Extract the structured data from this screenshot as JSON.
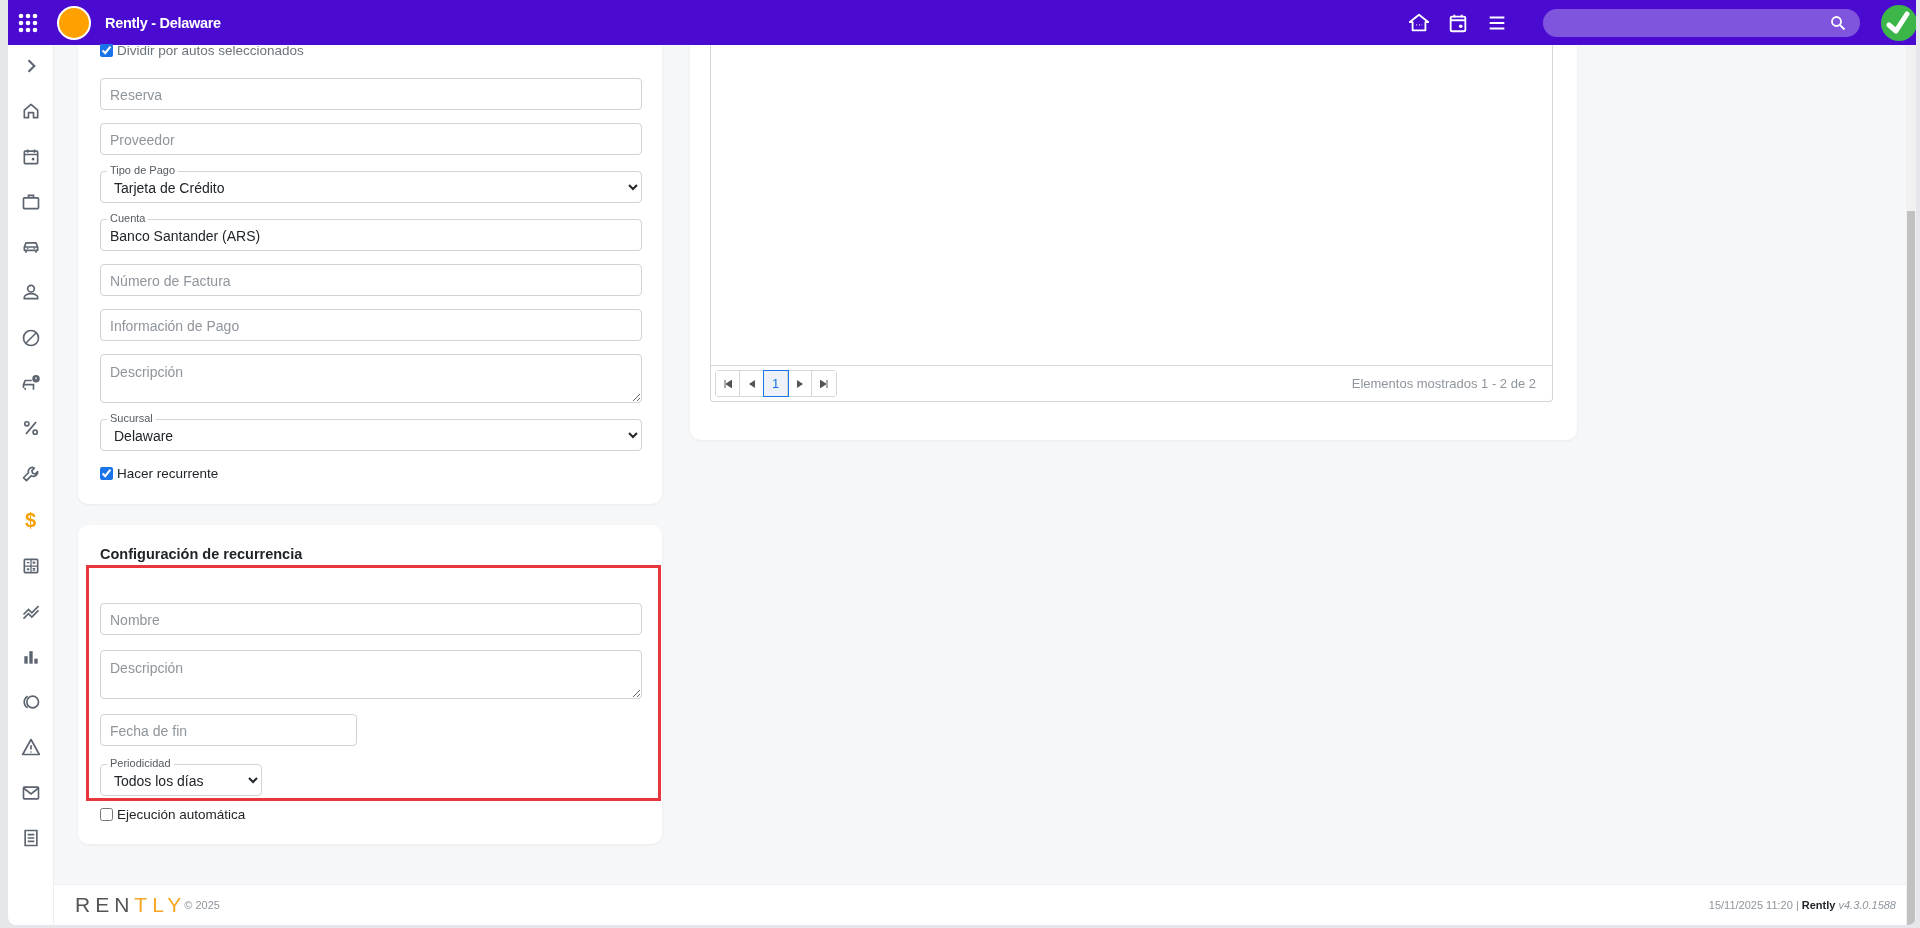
{
  "topbar": {
    "title": "Rently - Delaware"
  },
  "sidebar": {
    "items": [
      {
        "selected": false
      },
      {
        "selected": false
      },
      {
        "selected": false
      },
      {
        "selected": false
      },
      {
        "selected": false
      },
      {
        "selected": false
      },
      {
        "selected": false
      },
      {
        "selected": false
      },
      {
        "selected": false
      },
      {
        "selected": true,
        "glyph": "$"
      },
      {
        "selected": false
      },
      {
        "selected": false
      },
      {
        "selected": false
      },
      {
        "selected": false
      },
      {
        "selected": false
      },
      {
        "selected": false
      },
      {
        "selected": false
      }
    ]
  },
  "expense_form": {
    "fields": [
      {
        "kind": "checkbox",
        "label": "Dividir por autos seleccionados",
        "checked": true,
        "muted": true
      },
      {
        "kind": "input",
        "placeholder": "Reserva"
      },
      {
        "kind": "input",
        "placeholder": "Proveedor"
      },
      {
        "kind": "select",
        "label": "Tipo de Pago",
        "value": "Tarjeta de Crédito"
      },
      {
        "kind": "input",
        "label": "Cuenta",
        "value": "Banco Santander (ARS)"
      },
      {
        "kind": "input",
        "placeholder": "Número de Factura"
      },
      {
        "kind": "input",
        "placeholder": "Información de Pago"
      },
      {
        "kind": "textarea",
        "placeholder": "Descripción"
      },
      {
        "kind": "select",
        "label": "Sucursal",
        "value": "Delaware"
      },
      {
        "kind": "checkbox",
        "label": "Hacer recurrente",
        "checked": true,
        "muted": false
      }
    ]
  },
  "recurrence": {
    "title": "Configuración de recurrencia",
    "fields": [
      {
        "kind": "input",
        "placeholder": "Nombre"
      },
      {
        "kind": "textarea",
        "placeholder": "Descripción"
      },
      {
        "kind": "input",
        "placeholder": "Fecha de fin"
      },
      {
        "kind": "select",
        "label": "Periodicidad",
        "value": "Todos los días"
      }
    ],
    "after": [
      {
        "kind": "checkbox",
        "label": "Ejecución automática",
        "checked": false,
        "muted": false
      }
    ]
  },
  "grid": {
    "pager": {
      "pages": [
        {
          "label": "1",
          "selected": true
        }
      ],
      "info": "Elementos mostrados 1 - 2 de 2"
    }
  },
  "footer": {
    "logo": [
      {
        "text": "REN",
        "color": "#555555"
      },
      {
        "text": "TLY",
        "color": "#f5a623"
      }
    ],
    "copyright": "© 2025",
    "info": "15/11/2025 11:20  |  **Rently** *v4.3.0.1588*"
  }
}
